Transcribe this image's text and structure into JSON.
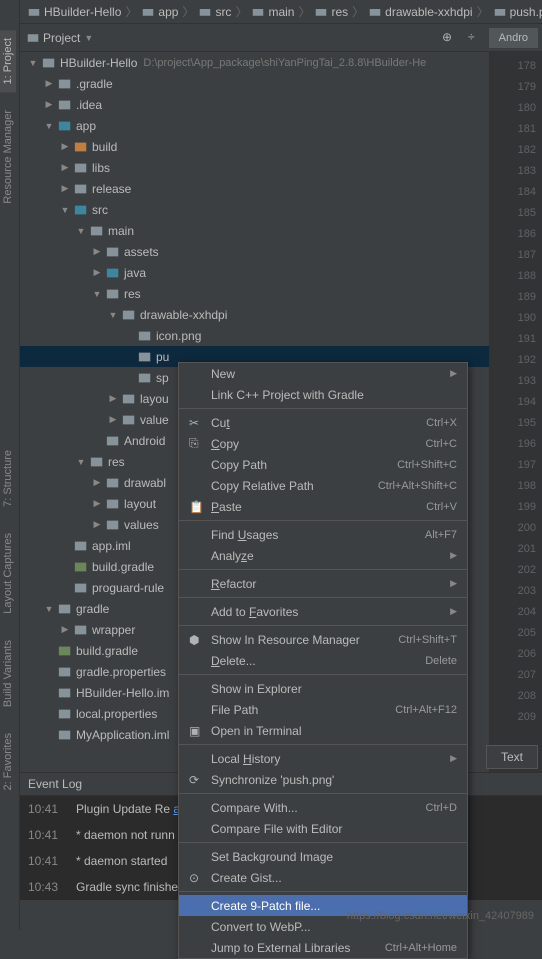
{
  "sidebar": {
    "tabs": [
      "1: Project",
      "Resource Manager",
      "7: Structure",
      "Layout Captures",
      "Build Variants",
      "2: Favorites"
    ]
  },
  "breadcrumb": [
    {
      "label": "HBuilder-Hello",
      "icon": "project"
    },
    {
      "label": "app",
      "icon": "folder"
    },
    {
      "label": "src",
      "icon": "folder"
    },
    {
      "label": "main",
      "icon": "folder"
    },
    {
      "label": "res",
      "icon": "folder"
    },
    {
      "label": "drawable-xxhdpi",
      "icon": "folder"
    },
    {
      "label": "push.png",
      "icon": "file"
    }
  ],
  "toolbar": {
    "title": "Project",
    "dropdown_icon": "▼"
  },
  "editor_tab": "Andro",
  "text_tab": "Text",
  "project_root": {
    "name": "HBuilder-Hello",
    "path": "D:\\project\\App_package\\shiYanPingTai_2.8.8\\HBuilder-He"
  },
  "tree": [
    {
      "depth": 0,
      "arrow": "open",
      "icon": "project",
      "label": "HBuilder-Hello",
      "hint": "D:\\project\\App_package\\shiYanPingTai_2.8.8\\HBuilder-He"
    },
    {
      "depth": 1,
      "arrow": "closed",
      "icon": "folder",
      "label": ".gradle"
    },
    {
      "depth": 1,
      "arrow": "closed",
      "icon": "folder",
      "label": ".idea"
    },
    {
      "depth": 1,
      "arrow": "open",
      "icon": "folder-blue",
      "label": "app"
    },
    {
      "depth": 2,
      "arrow": "closed",
      "icon": "folder-orange",
      "label": "build"
    },
    {
      "depth": 2,
      "arrow": "closed",
      "icon": "folder",
      "label": "libs"
    },
    {
      "depth": 2,
      "arrow": "closed",
      "icon": "folder",
      "label": "release"
    },
    {
      "depth": 2,
      "arrow": "open",
      "icon": "folder-blue",
      "label": "src"
    },
    {
      "depth": 3,
      "arrow": "open",
      "icon": "folder",
      "label": "main"
    },
    {
      "depth": 4,
      "arrow": "closed",
      "icon": "folder",
      "label": "assets"
    },
    {
      "depth": 4,
      "arrow": "closed",
      "icon": "folder-blue",
      "label": "java"
    },
    {
      "depth": 4,
      "arrow": "open",
      "icon": "folder",
      "label": "res"
    },
    {
      "depth": 5,
      "arrow": "open",
      "icon": "folder",
      "label": "drawable-xxhdpi"
    },
    {
      "depth": 6,
      "arrow": "",
      "icon": "file",
      "label": "icon.png"
    },
    {
      "depth": 6,
      "arrow": "",
      "icon": "file",
      "label": "pu",
      "selected": true
    },
    {
      "depth": 6,
      "arrow": "",
      "icon": "file",
      "label": "sp"
    },
    {
      "depth": 5,
      "arrow": "closed",
      "icon": "folder",
      "label": "layou"
    },
    {
      "depth": 5,
      "arrow": "closed",
      "icon": "folder",
      "label": "value"
    },
    {
      "depth": 4,
      "arrow": "",
      "icon": "file-x",
      "label": "Android"
    },
    {
      "depth": 3,
      "arrow": "open",
      "icon": "folder",
      "label": "res"
    },
    {
      "depth": 4,
      "arrow": "closed",
      "icon": "folder",
      "label": "drawabl"
    },
    {
      "depth": 4,
      "arrow": "closed",
      "icon": "folder",
      "label": "layout"
    },
    {
      "depth": 4,
      "arrow": "closed",
      "icon": "folder",
      "label": "values"
    },
    {
      "depth": 2,
      "arrow": "",
      "icon": "file",
      "label": "app.iml"
    },
    {
      "depth": 2,
      "arrow": "",
      "icon": "file-g",
      "label": "build.gradle"
    },
    {
      "depth": 2,
      "arrow": "",
      "icon": "file",
      "label": "proguard-rule"
    },
    {
      "depth": 1,
      "arrow": "open",
      "icon": "folder",
      "label": "gradle"
    },
    {
      "depth": 2,
      "arrow": "closed",
      "icon": "folder",
      "label": "wrapper"
    },
    {
      "depth": 1,
      "arrow": "",
      "icon": "file-g",
      "label": "build.gradle"
    },
    {
      "depth": 1,
      "arrow": "",
      "icon": "file",
      "label": "gradle.properties"
    },
    {
      "depth": 1,
      "arrow": "",
      "icon": "file",
      "label": "HBuilder-Hello.im"
    },
    {
      "depth": 1,
      "arrow": "",
      "icon": "file",
      "label": "local.properties"
    },
    {
      "depth": 1,
      "arrow": "",
      "icon": "file",
      "label": "MyApplication.iml"
    }
  ],
  "gutter_lines": [
    178,
    179,
    180,
    181,
    182,
    183,
    184,
    185,
    186,
    187,
    188,
    189,
    190,
    191,
    192,
    193,
    194,
    195,
    196,
    197,
    198,
    199,
    200,
    201,
    202,
    203,
    204,
    205,
    206,
    207,
    208,
    209
  ],
  "context_menu": [
    {
      "type": "item",
      "label": "New",
      "arrow": true
    },
    {
      "type": "item",
      "label": "Link C++ Project with Gradle"
    },
    {
      "type": "sep"
    },
    {
      "type": "item",
      "icon": "✂",
      "label": "Cut",
      "mnemonic": "t",
      "shortcut": "Ctrl+X"
    },
    {
      "type": "item",
      "icon": "⎘",
      "label": "Copy",
      "mnemonic": "C",
      "shortcut": "Ctrl+C"
    },
    {
      "type": "item",
      "label": "Copy Path",
      "shortcut": "Ctrl+Shift+C"
    },
    {
      "type": "item",
      "label": "Copy Relative Path",
      "shortcut": "Ctrl+Alt+Shift+C"
    },
    {
      "type": "item",
      "icon": "📋",
      "label": "Paste",
      "mnemonic": "P",
      "shortcut": "Ctrl+V"
    },
    {
      "type": "sep"
    },
    {
      "type": "item",
      "label": "Find Usages",
      "mnemonic": "U",
      "shortcut": "Alt+F7"
    },
    {
      "type": "item",
      "label": "Analyze",
      "mnemonic": "z",
      "arrow": true
    },
    {
      "type": "sep"
    },
    {
      "type": "item",
      "label": "Refactor",
      "mnemonic": "R",
      "arrow": true
    },
    {
      "type": "sep"
    },
    {
      "type": "item",
      "label": "Add to Favorites",
      "mnemonic": "F",
      "arrow": true
    },
    {
      "type": "sep"
    },
    {
      "type": "item",
      "icon": "⬢",
      "label": "Show In Resource Manager",
      "shortcut": "Ctrl+Shift+T"
    },
    {
      "type": "item",
      "label": "Delete...",
      "mnemonic": "D",
      "shortcut": "Delete"
    },
    {
      "type": "sep"
    },
    {
      "type": "item",
      "label": "Show in Explorer"
    },
    {
      "type": "item",
      "label": "File Path",
      "shortcut": "Ctrl+Alt+F12"
    },
    {
      "type": "item",
      "icon": "▣",
      "label": "Open in Terminal"
    },
    {
      "type": "sep"
    },
    {
      "type": "item",
      "label": "Local History",
      "mnemonic": "H",
      "arrow": true
    },
    {
      "type": "item",
      "icon": "⟳",
      "label": "Synchronize 'push.png'"
    },
    {
      "type": "sep"
    },
    {
      "type": "item",
      "label": "Compare With...",
      "shortcut": "Ctrl+D"
    },
    {
      "type": "item",
      "label": "Compare File with Editor"
    },
    {
      "type": "sep"
    },
    {
      "type": "item",
      "label": "Set Background Image"
    },
    {
      "type": "item",
      "icon": "⊙",
      "label": "Create Gist..."
    },
    {
      "type": "sep"
    },
    {
      "type": "item",
      "label": "Create 9-Patch file...",
      "highlighted": true
    },
    {
      "type": "item",
      "label": "Convert to WebP..."
    },
    {
      "type": "item",
      "label": "Jump to External Libraries",
      "shortcut": "Ctrl+Alt+Home"
    }
  ],
  "event_log": {
    "title": "Event Log",
    "rows": [
      {
        "time": "10:41",
        "msg": "Plugin Update Re",
        "link": "ate"
      },
      {
        "time": "10:41",
        "msg": "* daemon not runn"
      },
      {
        "time": "10:41",
        "msg": "* daemon started"
      },
      {
        "time": "10:43",
        "msg": "Gradle sync finishe"
      }
    ]
  },
  "watermark": "https://blog.csdn.net/weixin_42407989"
}
